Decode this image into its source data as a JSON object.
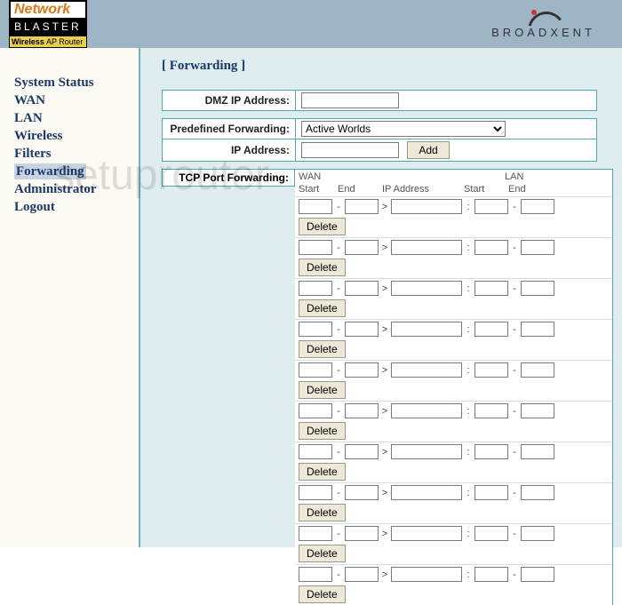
{
  "logo": {
    "top": "Network",
    "blaster": "BLASTER",
    "sub_wireless": "Wireless",
    "sub_ap": " AP Router"
  },
  "brand": "BROADXENT",
  "watermark": "setuprouter",
  "sidebar": {
    "items": [
      {
        "label": "System Status"
      },
      {
        "label": "WAN"
      },
      {
        "label": "LAN"
      },
      {
        "label": "Wireless"
      },
      {
        "label": "Filters"
      },
      {
        "label": "Forwarding"
      },
      {
        "label": "Administrator"
      },
      {
        "label": "Logout"
      }
    ],
    "active_index": 5
  },
  "page": {
    "title": "[ Forwarding ]",
    "dmz_label": "DMZ IP Address:",
    "dmz_value": "",
    "predef_label": "Predefined Forwarding:",
    "predef_selected": "Active Worlds",
    "ip_label": "IP Address:",
    "ip_value": "",
    "add_btn": "Add",
    "tcp_label": "TCP Port Forwarding:",
    "tcp_headers": {
      "wan": "WAN",
      "lan": "LAN",
      "start": "Start",
      "end": "End",
      "ip": "IP Address"
    },
    "delete_label": "Delete",
    "row_count": 10,
    "row_values": {
      "wan_start": "",
      "wan_end": "",
      "ip": "",
      "lan_start": "",
      "lan_end": ""
    }
  }
}
